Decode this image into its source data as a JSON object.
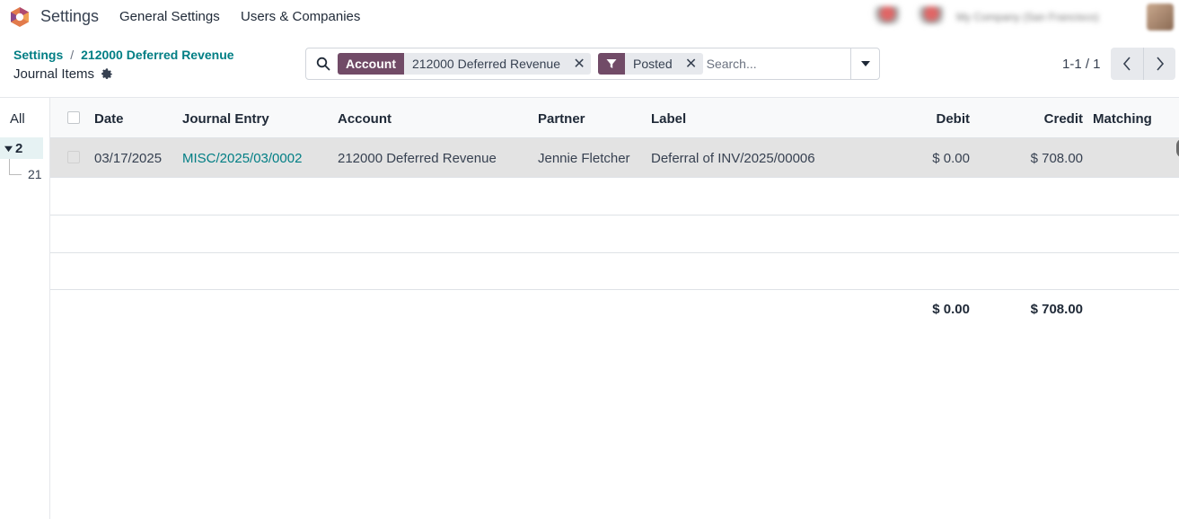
{
  "navbar": {
    "app_title": "Settings",
    "menu": [
      "General Settings",
      "Users & Companies"
    ],
    "company_name": "My Company (San Francisco)"
  },
  "control_panel": {
    "breadcrumb": [
      "Settings",
      "212000 Deferred Revenue"
    ],
    "title": "Journal Items"
  },
  "search": {
    "facets": [
      {
        "label": "Account",
        "value": "212000 Deferred Revenue"
      },
      {
        "label": "filter-icon",
        "value": "Posted"
      }
    ],
    "placeholder": "Search..."
  },
  "pager": {
    "value": "1-1 / 1"
  },
  "side_panel": {
    "all_label": "All",
    "group_label": "2",
    "child_label": "21"
  },
  "table": {
    "columns": [
      "Date",
      "Journal Entry",
      "Account",
      "Partner",
      "Label",
      "Debit",
      "Credit",
      "Matching"
    ],
    "rows": [
      {
        "date": "03/17/2025",
        "journal_entry": "MISC/2025/03/0002",
        "account": "212000 Deferred Revenue",
        "partner": "Jennie Fletcher",
        "label": "Deferral of INV/2025/00006",
        "debit": "$ 0.00",
        "credit": "$ 708.00",
        "matching": ""
      }
    ],
    "totals": {
      "debit": "$ 0.00",
      "credit": "$ 708.00"
    }
  },
  "colors": {
    "brand": "#714b67",
    "link": "#017e84",
    "selected_row": "#e3e3e3"
  }
}
